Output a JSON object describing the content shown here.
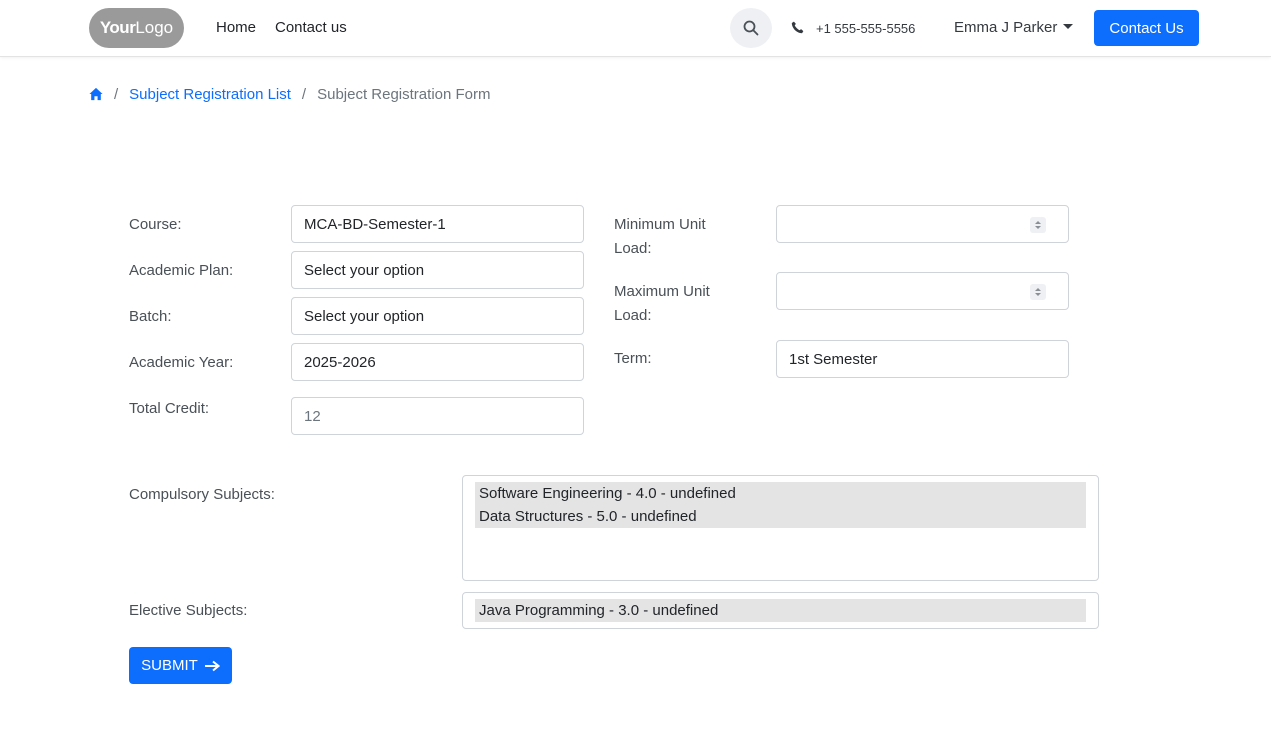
{
  "nav": {
    "logo_your": "Your",
    "logo_logo": "Logo",
    "home": "Home",
    "contact_us": "Contact us",
    "phone": "+1 555-555-5556",
    "user": "Emma J Parker",
    "contact_button": "Contact Us"
  },
  "breadcrumb": {
    "list": "Subject Registration List",
    "current": "Subject Registration Form"
  },
  "form": {
    "course_label": "Course:",
    "course_value": "MCA-BD-Semester-1",
    "academic_plan_label": "Academic Plan:",
    "academic_plan_value": "Select your option",
    "batch_label": "Batch:",
    "batch_value": "Select your option",
    "academic_year_label": "Academic Year:",
    "academic_year_value": "2025-2026",
    "total_credit_label": "Total Credit:",
    "total_credit_value": "12",
    "min_unit_label_1": "Minimum Unit",
    "min_unit_label_2": "Load:",
    "max_unit_label_1": "Maximum Unit",
    "max_unit_label_2": "Load:",
    "term_label": "Term:",
    "term_value": "1st Semester",
    "compulsory_label": "Compulsory Subjects:",
    "compulsory_options": [
      "Software Engineering - 4.0 - undefined",
      "Data Structures - 5.0 - undefined"
    ],
    "elective_label": "Elective Subjects:",
    "elective_options": [
      "Java Programming - 3.0 - undefined"
    ],
    "submit": "SUBMIT"
  },
  "colors": {
    "primary": "#0d6efd",
    "selected_option_bg": "#e4e4e4"
  }
}
